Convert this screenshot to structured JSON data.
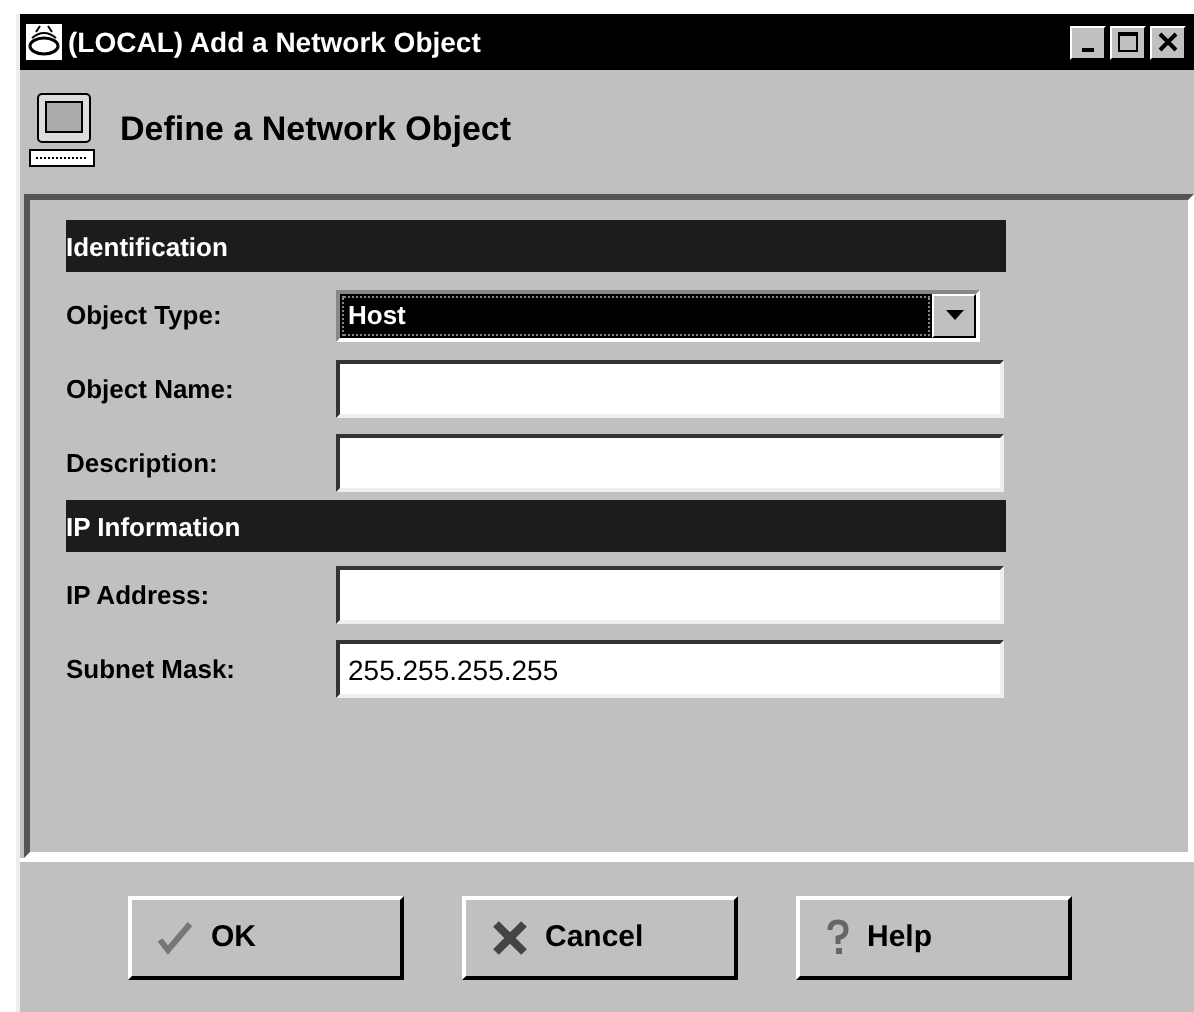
{
  "window": {
    "title": "(LOCAL) Add a Network Object"
  },
  "header": {
    "title": "Define a Network Object"
  },
  "sections": [
    {
      "title": "Identification",
      "fields": [
        {
          "kind": "dropdown",
          "label": "Object Type:",
          "value": "Host"
        },
        {
          "kind": "text",
          "label": "Object Name:"
        },
        {
          "kind": "text",
          "label": "Description:"
        }
      ]
    },
    {
      "title": "IP Information",
      "fields": [
        {
          "kind": "text",
          "label": "IP Address:"
        },
        {
          "kind": "text",
          "label": "Subnet Mask:",
          "value": "255.255.255.255"
        }
      ]
    }
  ],
  "buttons": [
    {
      "kind": "ok",
      "label": "OK"
    },
    {
      "kind": "cancel",
      "label": "Cancel"
    },
    {
      "kind": "help",
      "label": "Help"
    }
  ]
}
